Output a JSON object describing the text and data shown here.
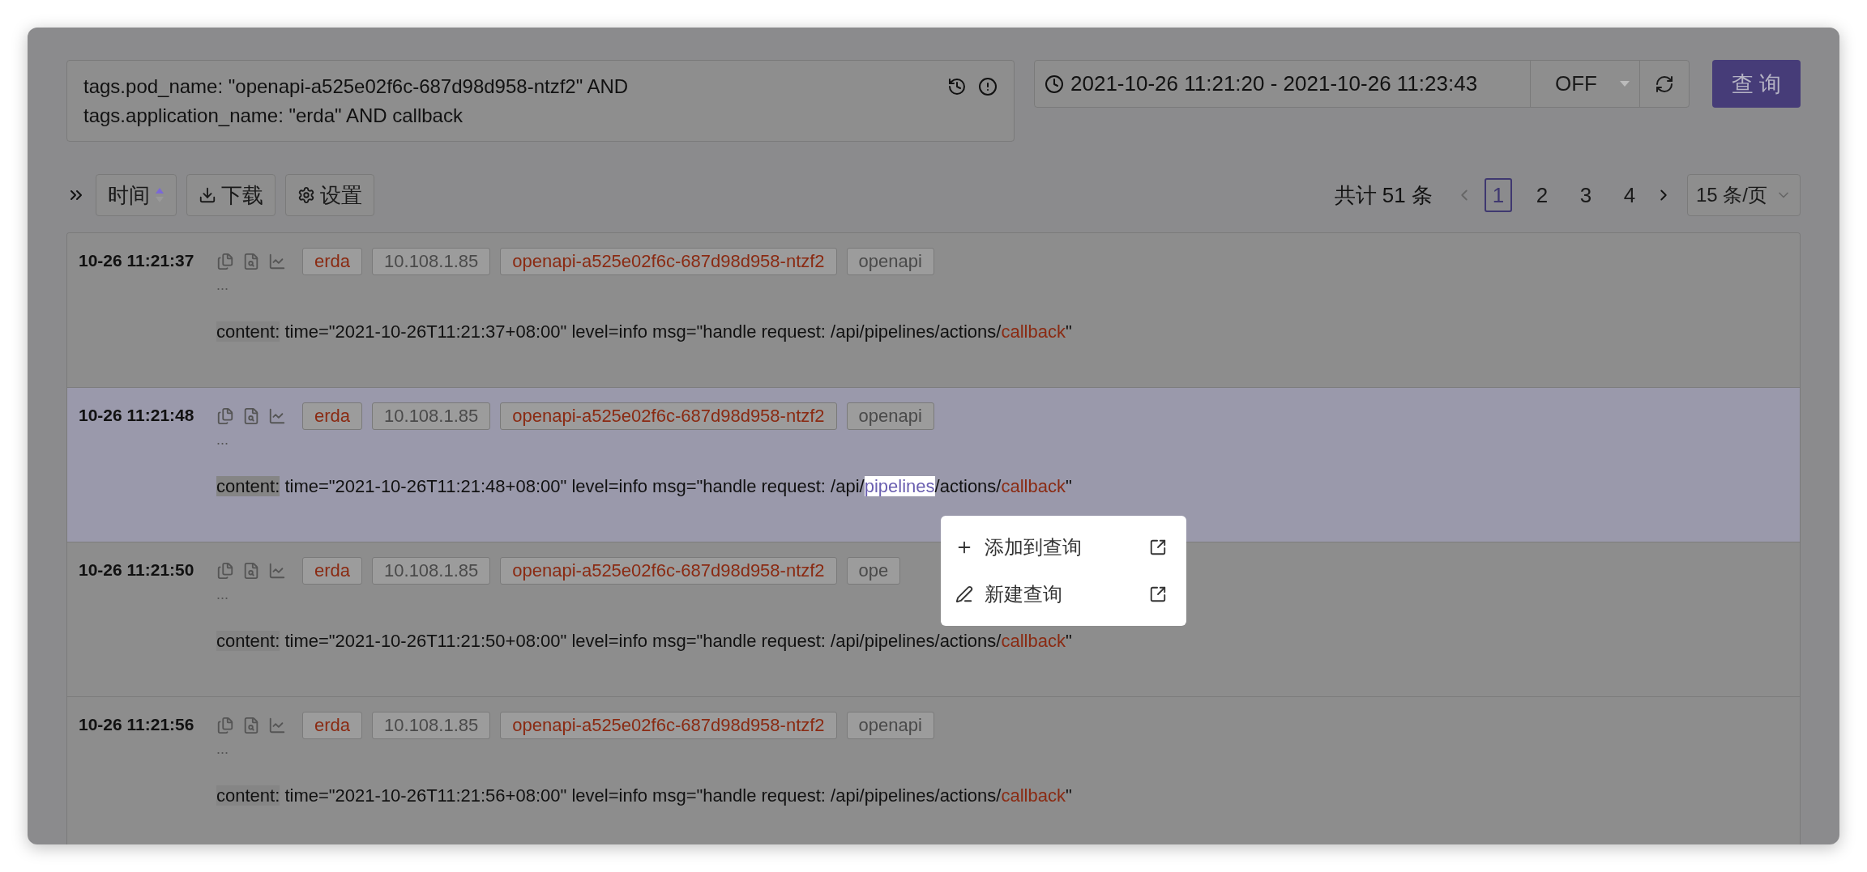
{
  "query": {
    "lines": [
      "tags.pod_name: \"openapi-a525e02f6c-687d98d958-ntzf2\" AND",
      "tags.application_name: \"erda\" AND callback"
    ]
  },
  "time_range": {
    "value": "2021-10-26 11:21:20 - 2021-10-26 11:23:43",
    "refresh": "OFF"
  },
  "query_button": "查 询",
  "toolbar": [
    {
      "label": "时间",
      "kind": "sort"
    },
    {
      "label": "下载",
      "kind": "download"
    },
    {
      "label": "设置",
      "kind": "settings"
    }
  ],
  "pagination": {
    "total": "共计 51 条",
    "pages": [
      {
        "label": "1",
        "selected": true
      },
      {
        "label": "2",
        "selected": false
      },
      {
        "label": "3",
        "selected": false
      },
      {
        "label": "4",
        "selected": false
      }
    ],
    "page_size": "15 条/页"
  },
  "rows": [
    {
      "time": "10-26 11:21:37",
      "selected": false,
      "tags": [
        {
          "text": "erda",
          "color": "#8a2a12"
        },
        {
          "text": "10.108.1.85",
          "color": "#4a4a4a"
        },
        {
          "text": "openapi-a525e02f6c-687d98d958-ntzf2",
          "color": "#8a2a12"
        },
        {
          "text": "openapi",
          "color": "#4a4a4a"
        }
      ],
      "ellipsis": "...",
      "label": "content:",
      "content": [
        {
          "text": " time=\"2021-10-26T11:21:37+08:00\" level=info msg=\"handle request: /api/pipelines/actions/",
          "kind": "plain"
        },
        {
          "text": "callback",
          "kind": "match"
        },
        {
          "text": "\"",
          "kind": "plain"
        }
      ]
    },
    {
      "time": "10-26 11:21:48",
      "selected": true,
      "tags": [
        {
          "text": "erda",
          "color": "#8a2a12"
        },
        {
          "text": "10.108.1.85",
          "color": "#4a4a4a"
        },
        {
          "text": "openapi-a525e02f6c-687d98d958-ntzf2",
          "color": "#8a2a12"
        },
        {
          "text": "openapi",
          "color": "#4a4a4a"
        }
      ],
      "ellipsis": "...",
      "label": "content:",
      "content": [
        {
          "text": " time=\"2021-10-26T11:21:48+08:00\" level=info msg=\"handle request: /api/",
          "kind": "plain"
        },
        {
          "text": "pipelines",
          "kind": "selection"
        },
        {
          "text": "/actions/",
          "kind": "plain"
        },
        {
          "text": "callback",
          "kind": "match"
        },
        {
          "text": "\"",
          "kind": "plain"
        }
      ]
    },
    {
      "time": "10-26 11:21:50",
      "selected": false,
      "tags": [
        {
          "text": "erda",
          "color": "#8a2a12"
        },
        {
          "text": "10.108.1.85",
          "color": "#4a4a4a"
        },
        {
          "text": "openapi-a525e02f6c-687d98d958-ntzf2",
          "color": "#8a2a12"
        },
        {
          "text": "ope",
          "color": "#4a4a4a"
        }
      ],
      "ellipsis": "...",
      "label": "content:",
      "content": [
        {
          "text": " time=\"2021-10-26T11:21:50+08:00\" level=info msg=\"handle request: /api/pipelines/actions/",
          "kind": "plain"
        },
        {
          "text": "callback",
          "kind": "match"
        },
        {
          "text": "\"",
          "kind": "plain"
        }
      ]
    },
    {
      "time": "10-26 11:21:56",
      "selected": false,
      "tags": [
        {
          "text": "erda",
          "color": "#8a2a12"
        },
        {
          "text": "10.108.1.85",
          "color": "#4a4a4a"
        },
        {
          "text": "openapi-a525e02f6c-687d98d958-ntzf2",
          "color": "#8a2a12"
        },
        {
          "text": "openapi",
          "color": "#4a4a4a"
        }
      ],
      "ellipsis": "...",
      "label": "content:",
      "content": [
        {
          "text": " time=\"2021-10-26T11:21:56+08:00\" level=info msg=\"handle request: /api/pipelines/actions/",
          "kind": "plain"
        },
        {
          "text": "callback",
          "kind": "match"
        },
        {
          "text": "\"",
          "kind": "plain"
        }
      ]
    }
  ],
  "context_menu": {
    "items": [
      {
        "label": "添加到查询",
        "kind": "add"
      },
      {
        "label": "新建查询",
        "kind": "new"
      }
    ]
  }
}
